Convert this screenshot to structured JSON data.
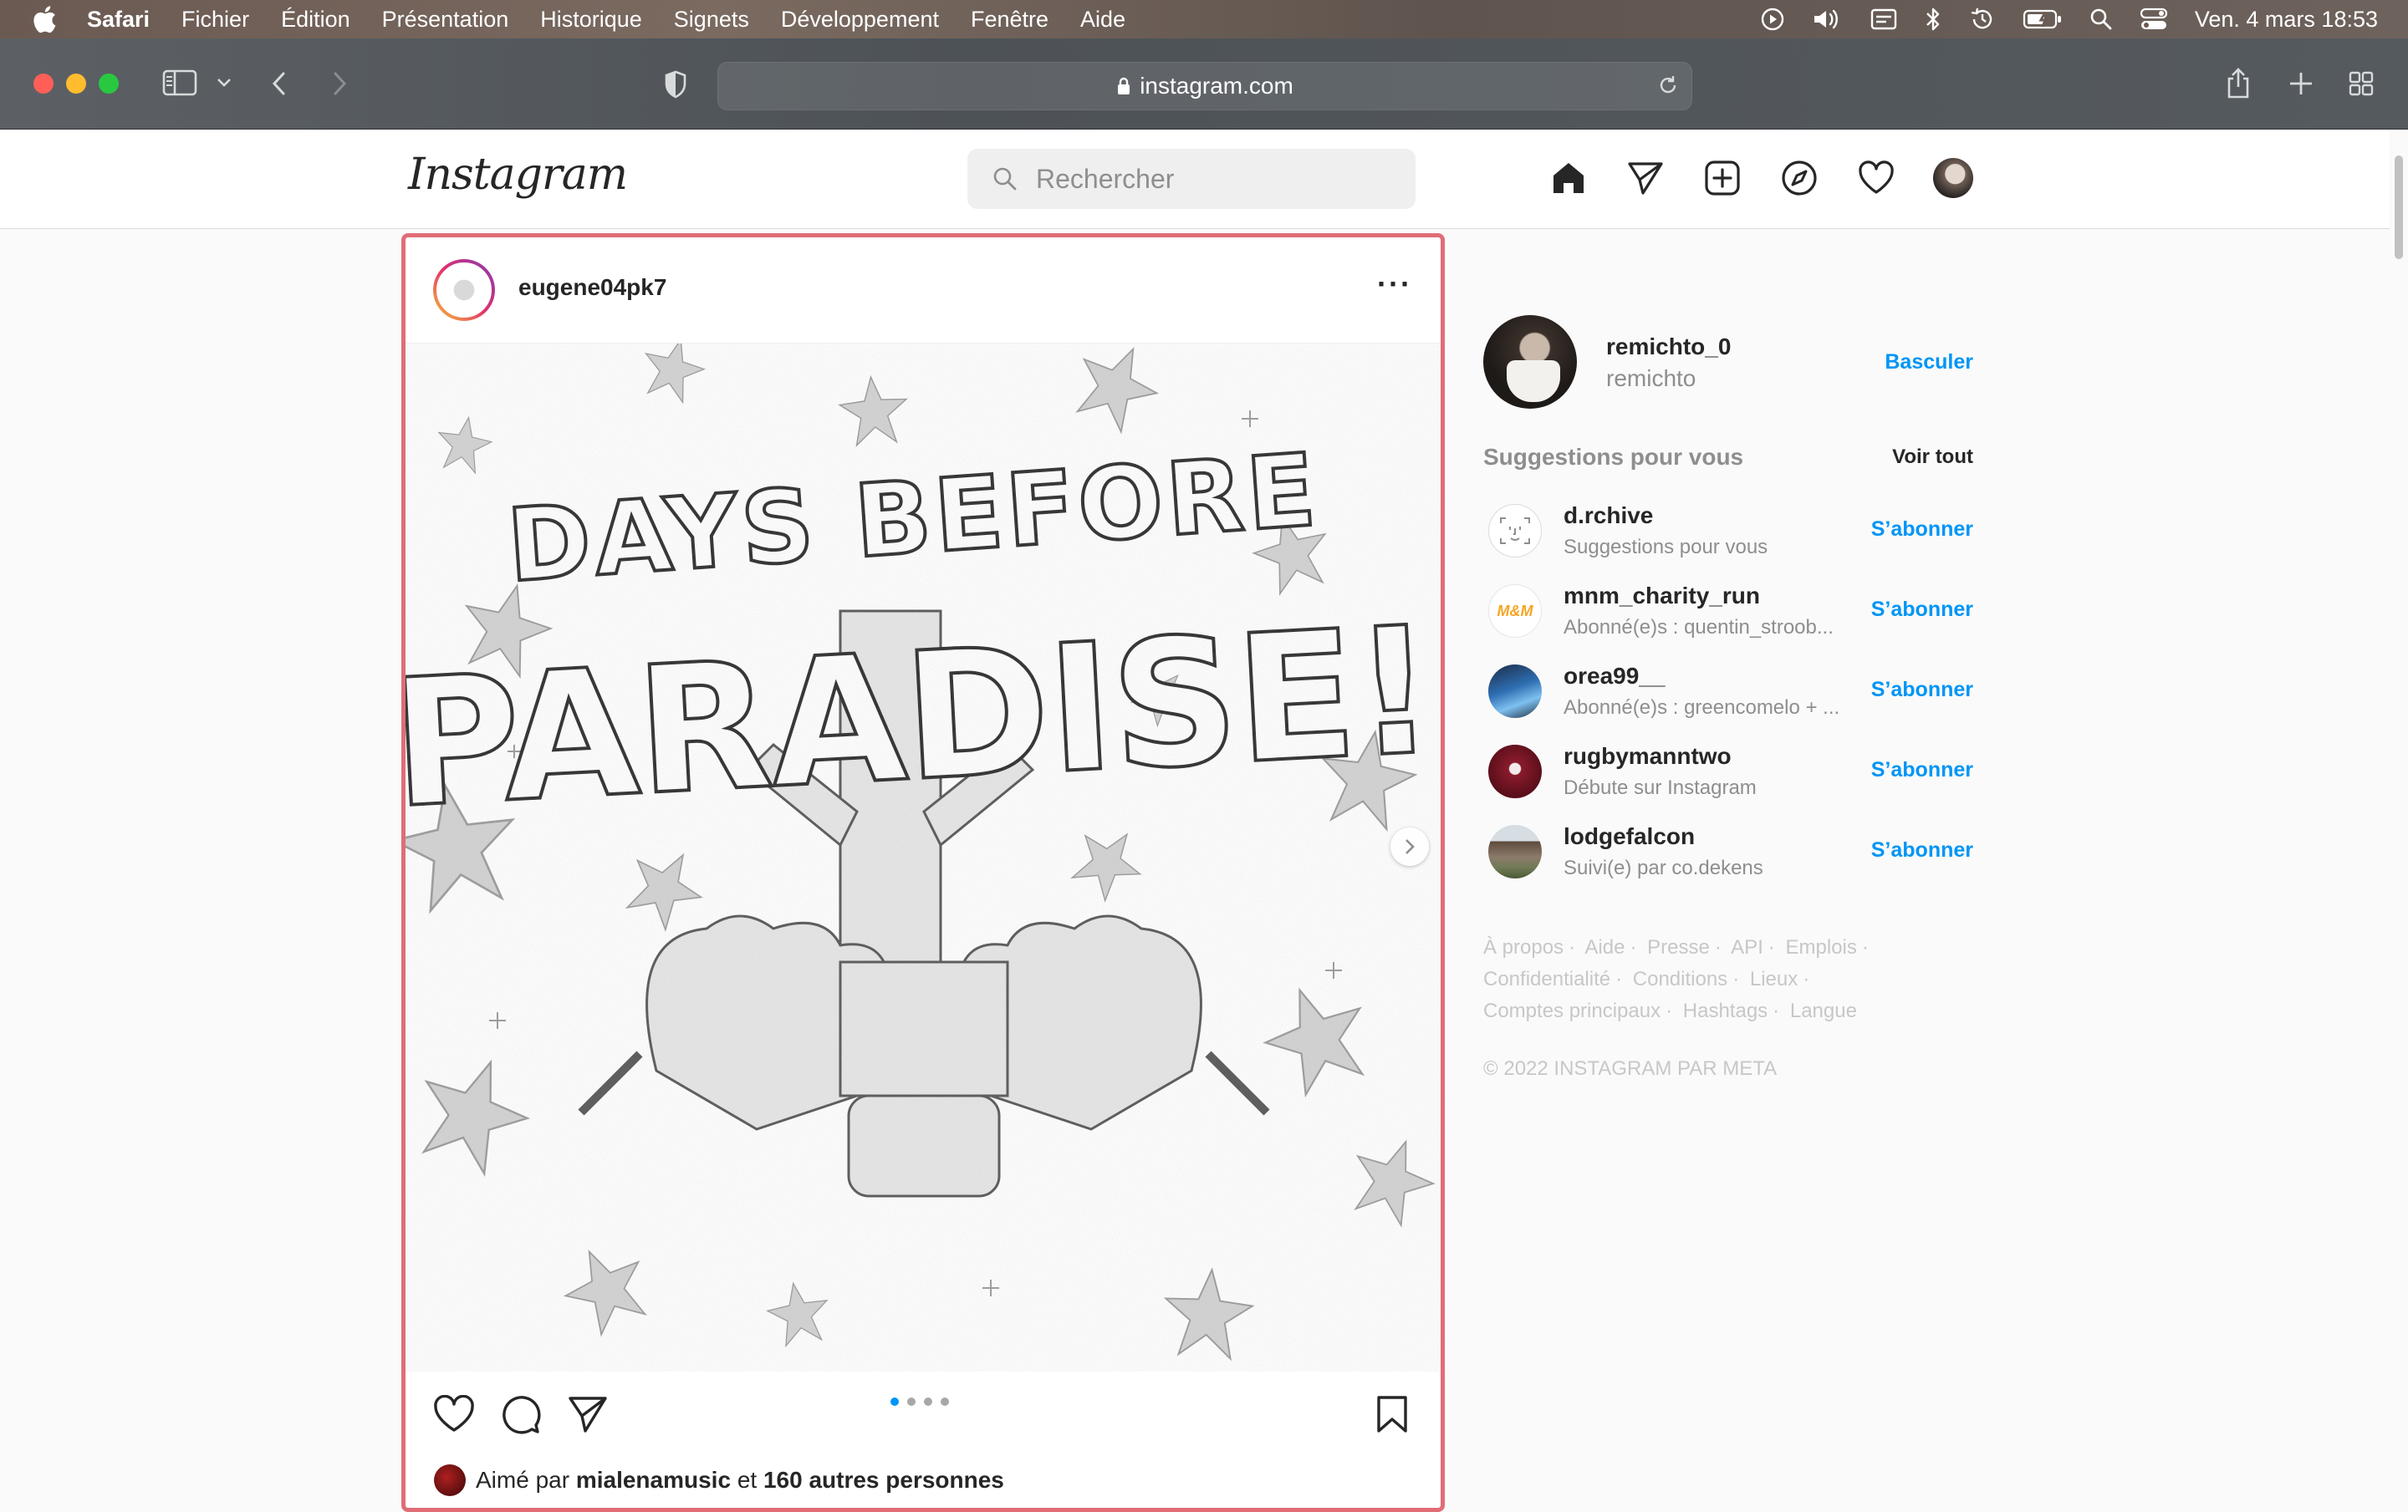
{
  "menubar": {
    "app": "Safari",
    "items": [
      "Fichier",
      "Édition",
      "Présentation",
      "Historique",
      "Signets",
      "Développement",
      "Fenêtre",
      "Aide"
    ],
    "clock": "Ven. 4 mars  18:53"
  },
  "browser": {
    "url": "instagram.com"
  },
  "header": {
    "logo": "Instagram",
    "search_placeholder": "Rechercher"
  },
  "post": {
    "username": "eugene04pk7",
    "image_title": "DAYS BEFORE PARADISE",
    "carousel_count": 4,
    "carousel_active": 1,
    "likes": {
      "prefix": "Aimé par",
      "user": "mialenamusic",
      "middle": "et",
      "others": "160 autres personnes"
    }
  },
  "sidebar": {
    "me": {
      "username": "remichto_0",
      "name": "remichto",
      "switch_label": "Basculer"
    },
    "suggestions_title": "Suggestions pour vous",
    "see_all": "Voir tout",
    "follow_label": "S’abonner",
    "suggestions": [
      {
        "username": "d.rchive",
        "sub": "Suggestions pour vous",
        "avatar": "face-id-icon"
      },
      {
        "username": "mnm_charity_run",
        "sub": "Abonné(e)s : quentin_stroob...",
        "avatar": "mnm-logo"
      },
      {
        "username": "orea99__",
        "sub": "Abonné(e)s : greencomelo + ...",
        "avatar": "photo"
      },
      {
        "username": "rugbymanntwo",
        "sub": "Débute sur Instagram",
        "avatar": "photo"
      },
      {
        "username": "lodgefalcon",
        "sub": "Suivi(e) par co.dekens",
        "avatar": "photo"
      }
    ],
    "footer_links": [
      "À propos",
      "Aide",
      "Presse",
      "API",
      "Emplois",
      "Confidentialité",
      "Conditions",
      "Lieux",
      "Comptes principaux",
      "Hashtags",
      "Langue"
    ],
    "copyright": "© 2022 INSTAGRAM PAR META"
  },
  "colors": {
    "accent": "#0095f6",
    "highlight_border": "#e06d78",
    "menubar": "#6b5a52"
  }
}
